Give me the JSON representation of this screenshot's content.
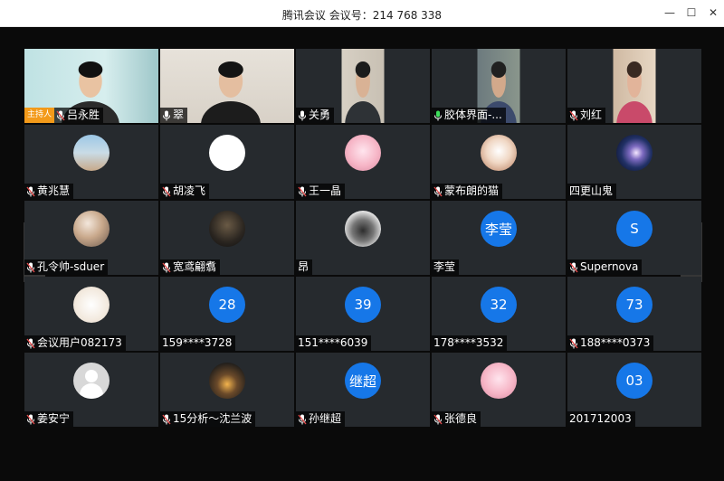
{
  "window": {
    "title": "腾讯会议 会议号：214 768 338",
    "controls": {
      "minimize": "—",
      "maximize": "☐",
      "close": "✕"
    }
  },
  "host_badge": "主持人",
  "participants": [
    {
      "name": "吕永胜",
      "host": true,
      "mic": "muted",
      "kind": "video"
    },
    {
      "name": "翠",
      "mic": "on",
      "kind": "video"
    },
    {
      "name": "关勇",
      "mic": "on",
      "kind": "video"
    },
    {
      "name": "胶体界面-...",
      "mic": "speaking",
      "kind": "video"
    },
    {
      "name": "刘红",
      "mic": "muted",
      "kind": "video"
    },
    {
      "name": "黄兆慧",
      "mic": "muted",
      "kind": "avatar",
      "avatar": "beach"
    },
    {
      "name": "胡凌飞",
      "mic": "muted",
      "kind": "avatar",
      "avatar": "panda"
    },
    {
      "name": "王一晶",
      "mic": "muted",
      "kind": "avatar",
      "avatar": "pink"
    },
    {
      "name": "蒙布朗的猫",
      "mic": "muted",
      "kind": "avatar",
      "avatar": "cat"
    },
    {
      "name": "四更山鬼",
      "mic": "none",
      "kind": "avatar",
      "avatar": "galaxy"
    },
    {
      "name": "孔令帅-sduer",
      "mic": "muted",
      "kind": "avatar",
      "avatar": "photo"
    },
    {
      "name": "宽鸢翩翥",
      "mic": "muted",
      "kind": "avatar",
      "avatar": "dark"
    },
    {
      "name": "昂",
      "mic": "none",
      "kind": "avatar",
      "avatar": "sketch"
    },
    {
      "name": "李莹",
      "mic": "none",
      "kind": "initials",
      "initials": "李莹"
    },
    {
      "name": "Supernova",
      "mic": "muted",
      "kind": "initials",
      "initials": "S"
    },
    {
      "name": "会议用户082173",
      "mic": "muted",
      "kind": "avatar",
      "avatar": "cream"
    },
    {
      "name": "159****3728",
      "mic": "none",
      "kind": "initials",
      "initials": "28"
    },
    {
      "name": "151****6039",
      "mic": "none",
      "kind": "initials",
      "initials": "39"
    },
    {
      "name": "178****3532",
      "mic": "none",
      "kind": "initials",
      "initials": "32"
    },
    {
      "name": "188****0373",
      "mic": "muted",
      "kind": "initials",
      "initials": "73"
    },
    {
      "name": "姜安宁",
      "mic": "muted",
      "kind": "avatar",
      "avatar": "grey"
    },
    {
      "name": "15分析～沈兰波",
      "mic": "muted",
      "kind": "avatar",
      "avatar": "lights"
    },
    {
      "name": "孙继超",
      "mic": "muted",
      "kind": "initials",
      "initials": "继超"
    },
    {
      "name": "张德良",
      "mic": "muted",
      "kind": "avatar",
      "avatar": "pink"
    },
    {
      "name": "201712003",
      "mic": "none",
      "kind": "initials",
      "initials": "03"
    }
  ],
  "colors": {
    "accent": "#1677e8",
    "host_badge": "#f39a1a",
    "tile_bg": "#262a2e",
    "speaking": "#3ddc5a",
    "muted": "#e24b4b"
  },
  "nav": {
    "prev_icon": "triangle-left-icon",
    "next_icon": "triangle-right-icon"
  }
}
